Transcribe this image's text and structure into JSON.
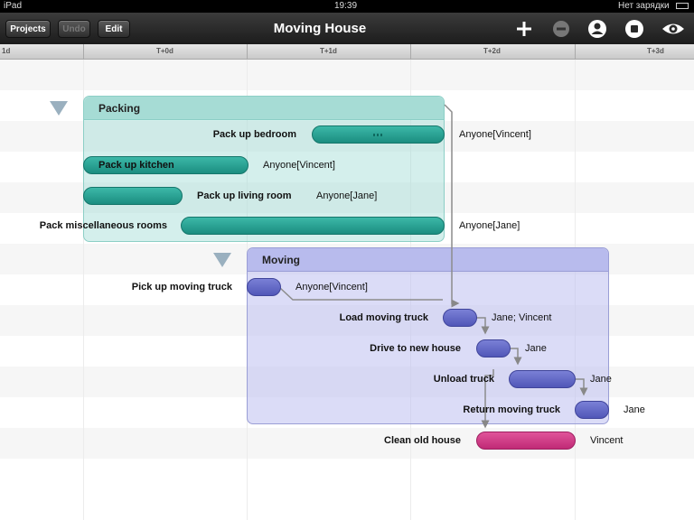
{
  "status_bar": {
    "device": "iPad",
    "time": "19:39",
    "battery": "Нет зарядки"
  },
  "toolbar": {
    "projects_label": "Projects",
    "undo_label": "Undo",
    "edit_label": "Edit",
    "title": "Moving House",
    "icons": [
      "plus-icon",
      "minus-icon",
      "person-icon",
      "stop-icon",
      "eye-icon"
    ]
  },
  "ruler": {
    "ticks": [
      "1d",
      "T+0d",
      "T+1d",
      "T+2d",
      "T+3d"
    ]
  },
  "groups": [
    {
      "name": "Packing",
      "tasks": [
        {
          "name": "Pack up bedroom",
          "resource": "Anyone[Vincent]"
        },
        {
          "name": "Pack up kitchen",
          "resource": "Anyone[Vincent]"
        },
        {
          "name": "Pack up living room",
          "resource": "Anyone[Jane]"
        },
        {
          "name": "Pack miscellaneous rooms",
          "resource": "Anyone[Jane]"
        }
      ]
    },
    {
      "name": "Moving",
      "tasks": [
        {
          "name": "Pick up moving truck",
          "resource": "Anyone[Vincent]"
        },
        {
          "name": "Load moving truck",
          "resource": "Jane; Vincent"
        },
        {
          "name": "Drive to new house",
          "resource": "Jane"
        },
        {
          "name": "Unload truck",
          "resource": "Jane"
        },
        {
          "name": "Return moving truck",
          "resource": "Jane"
        }
      ]
    }
  ],
  "standalone_tasks": [
    {
      "name": "Clean old house",
      "resource": "Vincent"
    }
  ],
  "colors": {
    "packing": "#1b8d80",
    "moving": "#5157b8",
    "clean": "#c02a76"
  }
}
